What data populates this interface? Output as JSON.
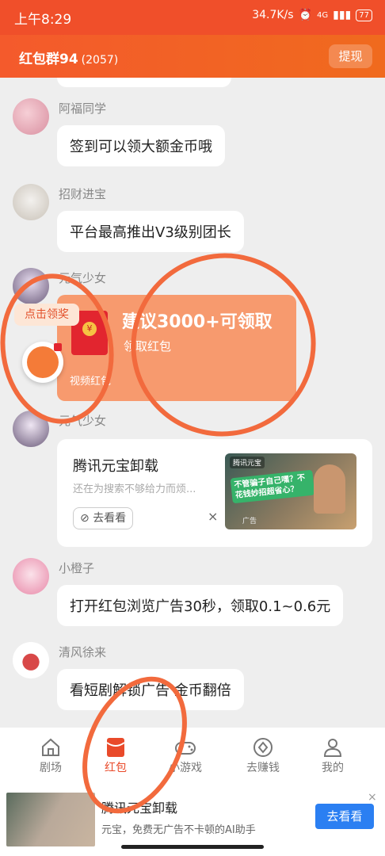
{
  "status": {
    "time": "上午8:29",
    "speed": "34.7K/s",
    "net": "4G",
    "battery": "77"
  },
  "header": {
    "title": "红包群94",
    "count": "(2057)",
    "withdraw": "提现"
  },
  "messages": [
    {
      "name": "阿福同学",
      "text": "签到可以领大额金币哦"
    },
    {
      "name": "招财进宝",
      "text": "平台最高推出V3级别团长"
    },
    {
      "name": "元气少女"
    },
    {
      "name": "元气少女"
    },
    {
      "name": "小橙子",
      "text": "打开红包浏览广告30秒，领取0.1~0.6元"
    },
    {
      "name": "清风徐来",
      "text": "看短剧解锁广告 金币翻倍"
    }
  ],
  "redpacket": {
    "title": "建议3000+可领取",
    "subtitle": "领取红包",
    "footer": "视频红包"
  },
  "float": {
    "label": "点击领奖"
  },
  "ad_card": {
    "title": "腾讯元宝卸载",
    "subtitle": "还在为搜索不够给力而烦...",
    "button": "去看看",
    "close": "×",
    "thumb_text": "不管骗子自己嘿？不花钱妙招超省心？",
    "thumb_badge": "腾讯元宝",
    "thumb_ad": "广告"
  },
  "tabs": [
    {
      "label": "剧场",
      "icon": "house-icon"
    },
    {
      "label": "红包",
      "icon": "red-envelope-icon",
      "active": true
    },
    {
      "label": "小游戏",
      "icon": "gamepad-icon"
    },
    {
      "label": "去赚钱",
      "icon": "coin-icon"
    },
    {
      "label": "我的",
      "icon": "person-icon"
    }
  ],
  "bottom_ad": {
    "title": "腾讯元宝卸载",
    "desc": "元宝，免费无广告不卡顿的AI助手",
    "button": "去看看",
    "close": "×"
  },
  "colors": {
    "brand": "#f04f2a",
    "active_tab": "#e94a2a",
    "redpacket": "#f79a6e",
    "ad_button": "#2b7ff2",
    "annotation": "#f26a3d"
  }
}
